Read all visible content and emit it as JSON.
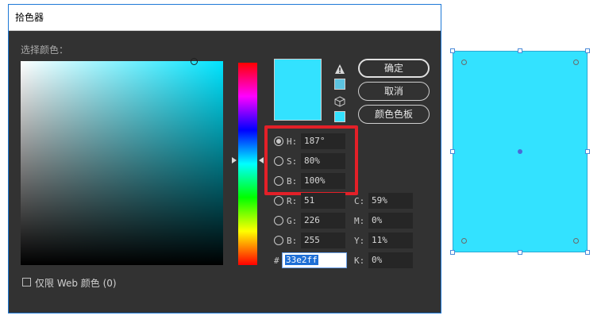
{
  "dialog": {
    "title": "拾色器",
    "select_color_label": "选择颜色：",
    "web_only_label": "仅限 Web 颜色 (0)"
  },
  "buttons": {
    "ok": "确定",
    "cancel": "取消",
    "swatches": "颜色色板"
  },
  "hsb": {
    "h_label": "H:",
    "h_value": "187°",
    "s_label": "S:",
    "s_value": "80%",
    "b_label": "B:",
    "b_value": "100%",
    "selected": "H"
  },
  "rgb": {
    "r_label": "R:",
    "r_value": "51",
    "g_label": "G:",
    "g_value": "226",
    "b_label": "B:",
    "b_value": "255"
  },
  "cmyk": {
    "c_label": "C:",
    "c_value": "59%",
    "m_label": "M:",
    "m_value": "0%",
    "y_label": "Y:",
    "y_value": "11%",
    "k_label": "K:",
    "k_value": "0%"
  },
  "hex": {
    "label": "#",
    "value": "33e2ff"
  },
  "colors": {
    "current": "#33e2ff",
    "hue_base": "#00e4ff",
    "web_safe_swatch": "#5cc3e0",
    "highlight_box": "#e32028"
  },
  "icons": [
    "warning-icon",
    "cube-icon"
  ]
}
